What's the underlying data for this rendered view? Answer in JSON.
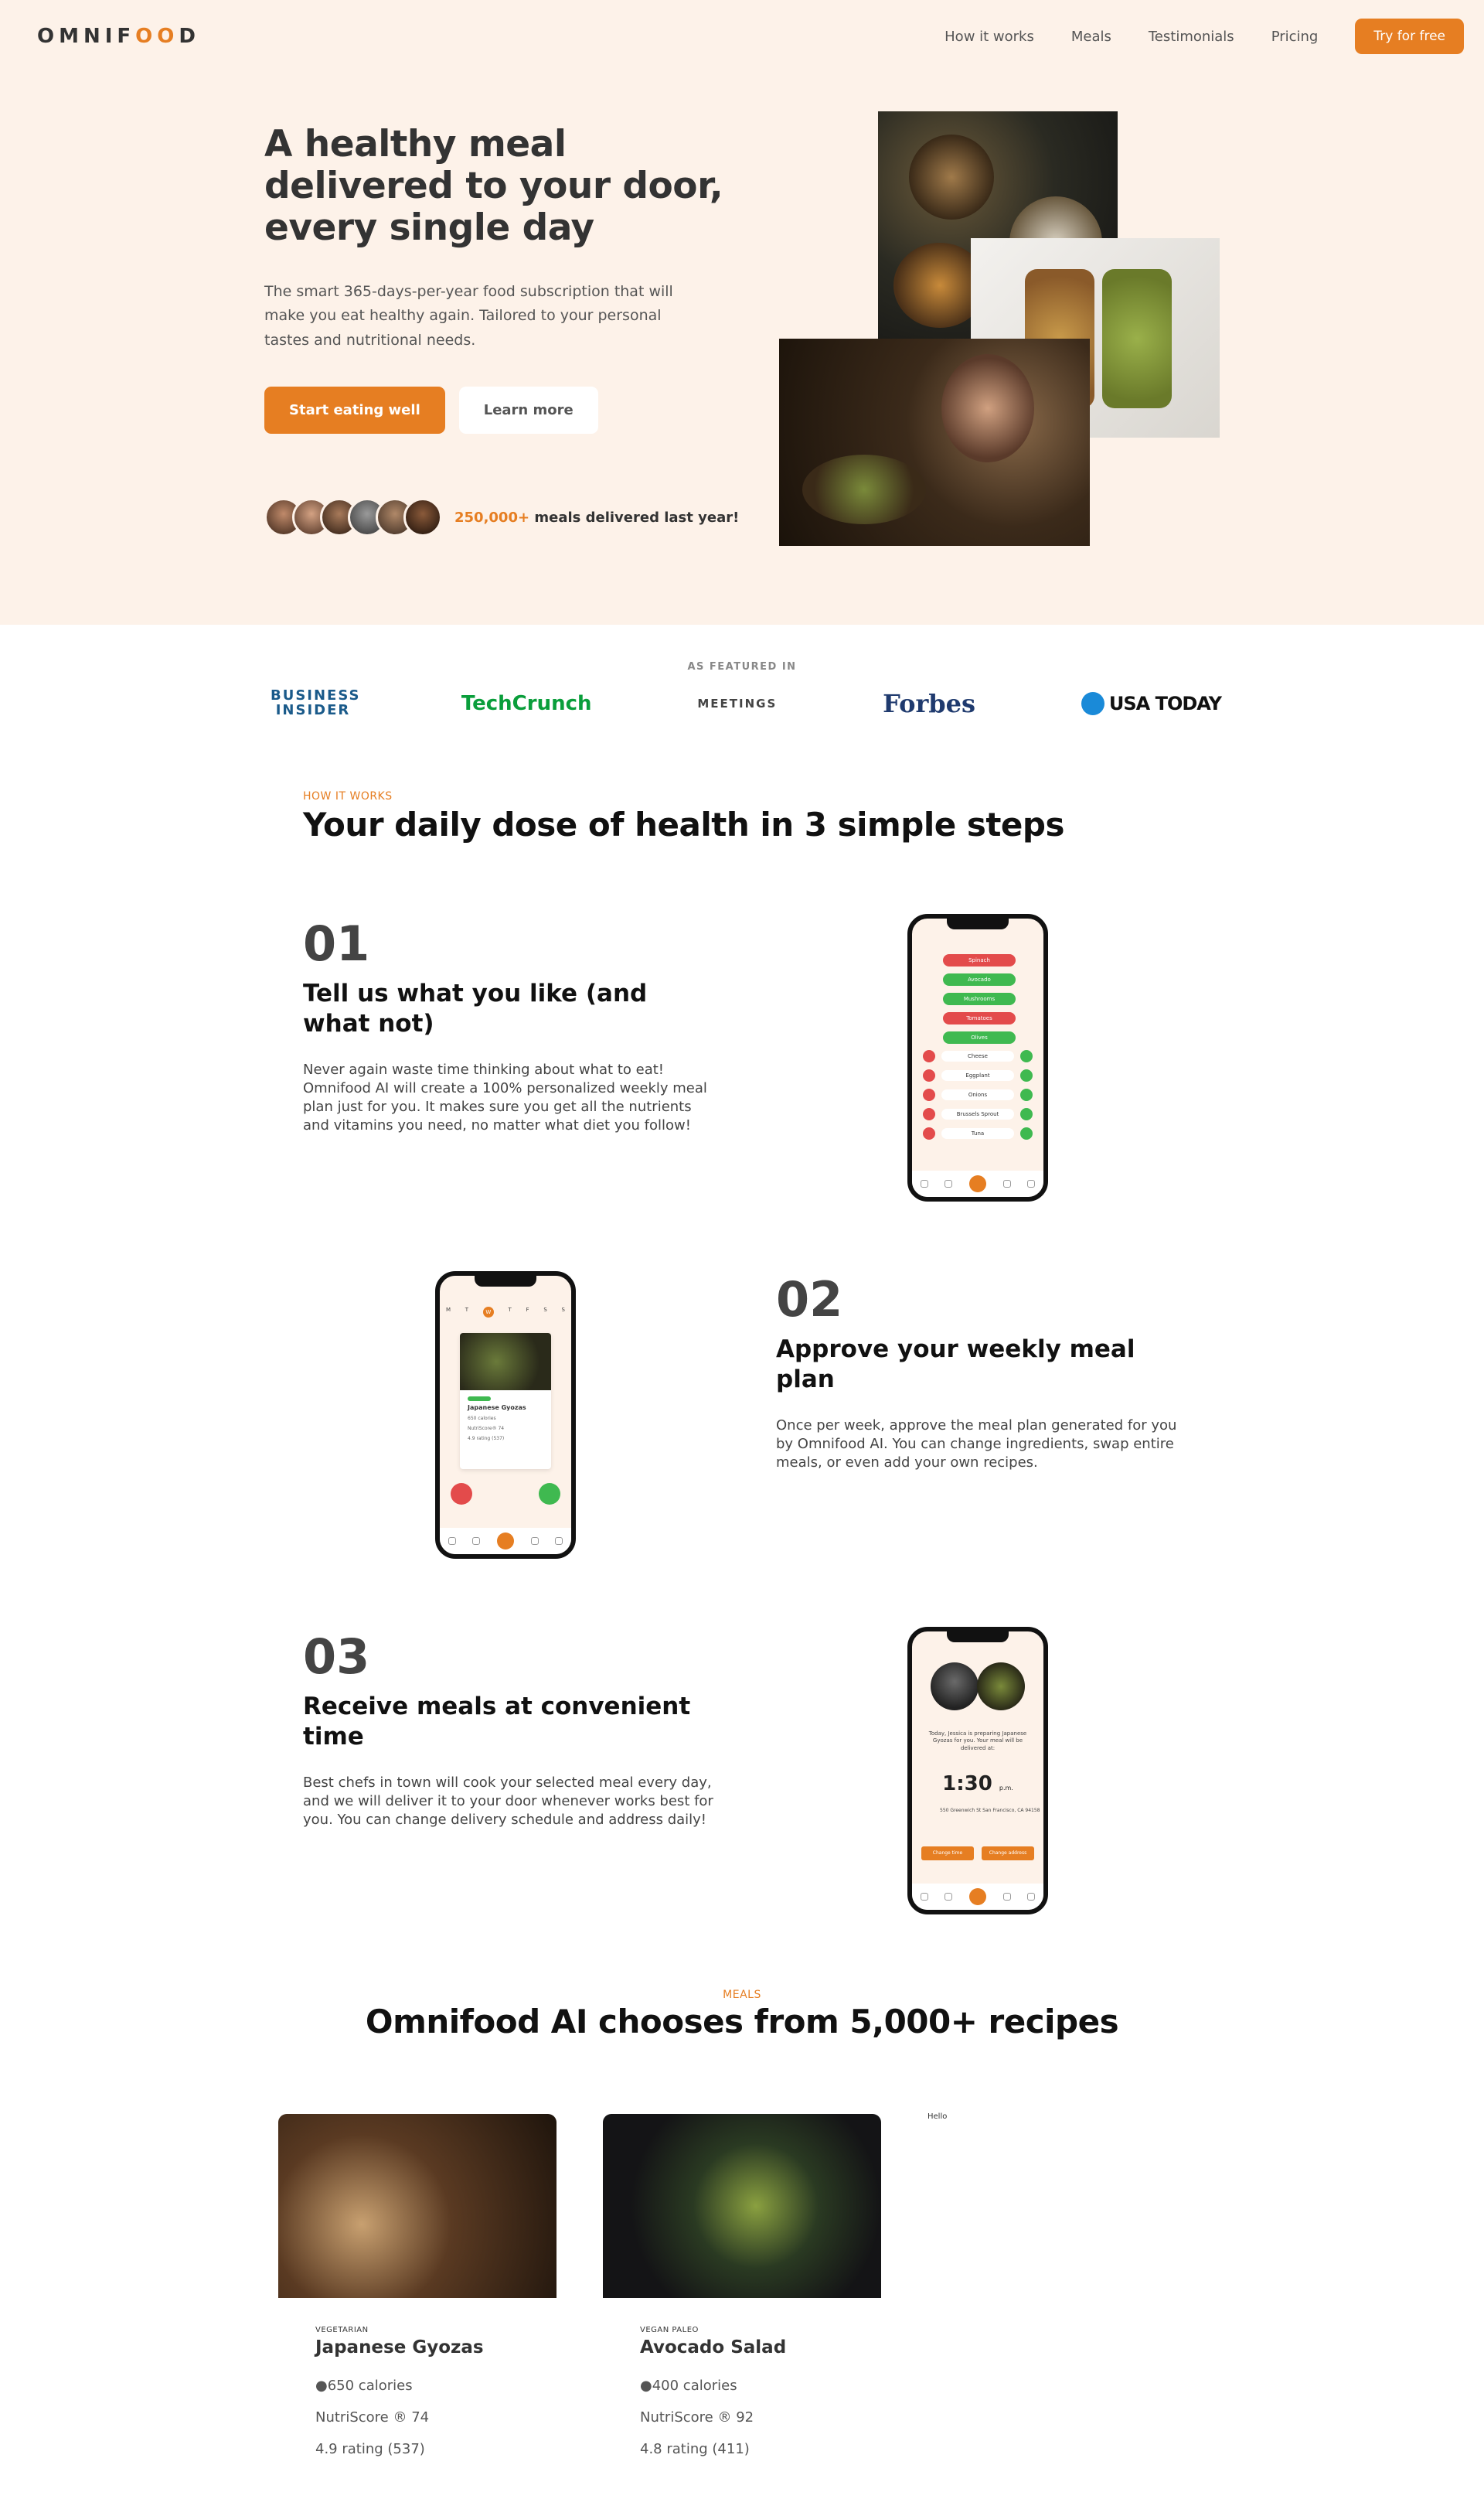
{
  "header": {
    "logo_text_1": "OMNIF",
    "logo_text_oo": "OO",
    "logo_text_2": "D",
    "nav": [
      "How it works",
      "Meals",
      "Testimonials",
      "Pricing"
    ],
    "cta": "Try for free"
  },
  "hero": {
    "title": "A healthy meal delivered to your door, every single day",
    "description": "The smart 365-days-per-year food subscription that will make you eat healthy again. Tailored to your personal tastes and nutritional needs.",
    "primary_button": "Start eating well",
    "secondary_button": "Learn more",
    "delivered_count": "250,000+",
    "delivered_rest": "meals delivered last year!"
  },
  "featured": {
    "label": "AS FEATURED IN",
    "logos": [
      "BUSINESS INSIDER",
      "TechCrunch",
      "MEETINGS",
      "Forbes",
      "USA TODAY"
    ]
  },
  "how": {
    "subheading": "HOW IT WORKS",
    "heading": "Your daily dose of health in 3 simple steps",
    "steps": [
      {
        "num": "01",
        "title": "Tell us what you like (and what not)",
        "desc": "Never again waste time thinking about what to eat! Omnifood AI will create a 100% personalized weekly meal plan just for you. It makes sure you get all the nutrients and vitamins you need, no matter what diet you follow!"
      },
      {
        "num": "02",
        "title": "Approve your weekly meal plan",
        "desc": "Once per week, approve the meal plan generated for you by Omnifood AI. You can change ingredients, swap entire meals, or even add your own recipes."
      },
      {
        "num": "03",
        "title": "Receive meals at convenient time",
        "desc": "Best chefs in town will cook your selected meal every day, and we will deliver it to your door whenever works best for you. You can change delivery schedule and address daily!"
      }
    ],
    "phone1": {
      "pills": [
        "Spinach",
        "Avocado",
        "Mushrooms",
        "Tomatoes",
        "Olives"
      ],
      "rows": [
        "Cheese",
        "Eggplant",
        "Onions",
        "Brussels Sprout",
        "Tuna"
      ]
    },
    "phone2": {
      "days": [
        "M",
        "T",
        "W",
        "T",
        "F",
        "S",
        "S"
      ],
      "meal_title": "Japanese Gyozas",
      "lines": [
        "650 calories",
        "NutriScore® 74",
        "4.9 rating (537)"
      ]
    },
    "phone3": {
      "text": "Today, Jessica is preparing Japanese Gyozas for you. Your meal will be delivered at:",
      "time": "1:30",
      "time_suffix": "p.m.",
      "address": "550 Greenwich St San Francisco, CA 94158",
      "btn_time": "Change time",
      "btn_address": "Change address"
    }
  },
  "meals": {
    "subheading": "MEALS",
    "heading": "Omnifood AI chooses from 5,000+ recipes",
    "hello": "Hello",
    "items": [
      {
        "tag": "VEGETARIAN",
        "title": "Japanese Gyozas",
        "calories": "650 calories",
        "nutri": "NutriScore ® 74",
        "rating": "4.9 rating (537)"
      },
      {
        "tag": "VEGAN PALEO",
        "title": "Avocado Salad",
        "calories": "400 calories",
        "nutri": "NutriScore ® 92",
        "rating": "4.8 rating (411)"
      }
    ]
  },
  "colors": {
    "accent": "#e67e22",
    "hero_bg": "#fdf2e9",
    "green": "#3fb950",
    "red": "#e34b4b"
  }
}
